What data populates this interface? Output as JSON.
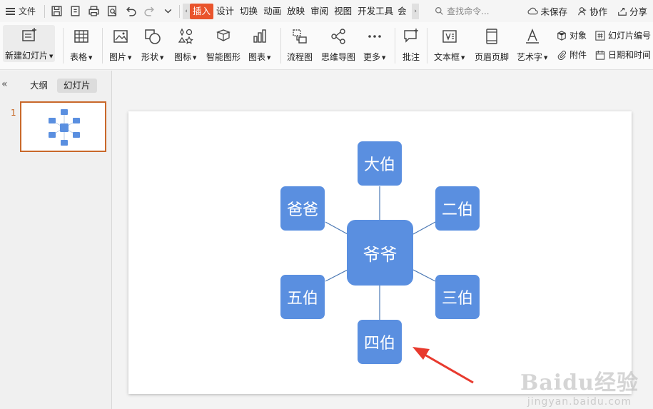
{
  "topbar": {
    "file_label": "文件",
    "tabs": [
      "插入",
      "设计",
      "切换",
      "动画",
      "放映",
      "审阅",
      "视图",
      "开发工具",
      "会员"
    ],
    "active_tab": "插入",
    "search_placeholder": "查找命令...",
    "unsaved_label": "未保存",
    "collab_label": "协作",
    "share_label": "分享"
  },
  "ribbon": {
    "new_slide": "新建幻灯片",
    "table": "表格",
    "picture": "图片",
    "shape": "形状",
    "icon": "图标",
    "smartart": "智能图形",
    "chart": "图表",
    "flowchart": "流程图",
    "mindmap": "思维导图",
    "more": "更多",
    "comment": "批注",
    "textbox": "文本框",
    "header_footer": "页眉页脚",
    "wordart": "艺术字",
    "object": "对象",
    "attachment": "附件",
    "slide_number": "幻灯片编号",
    "date_time": "日期和时间"
  },
  "panel": {
    "outline_tab": "大纲",
    "slides_tab": "幻灯片",
    "slide_number": "1"
  },
  "diagram": {
    "center": "爷爷",
    "nodes": [
      "大伯",
      "二伯",
      "三伯",
      "四伯",
      "五伯",
      "爸爸"
    ]
  },
  "watermark": {
    "logo": "Baidu经验",
    "url": "jingyan.baidu.com"
  },
  "colors": {
    "accent": "#e9542c",
    "node": "#5a8fe0",
    "arrow": "#e83a2e",
    "thumb_border": "#c9682a"
  }
}
